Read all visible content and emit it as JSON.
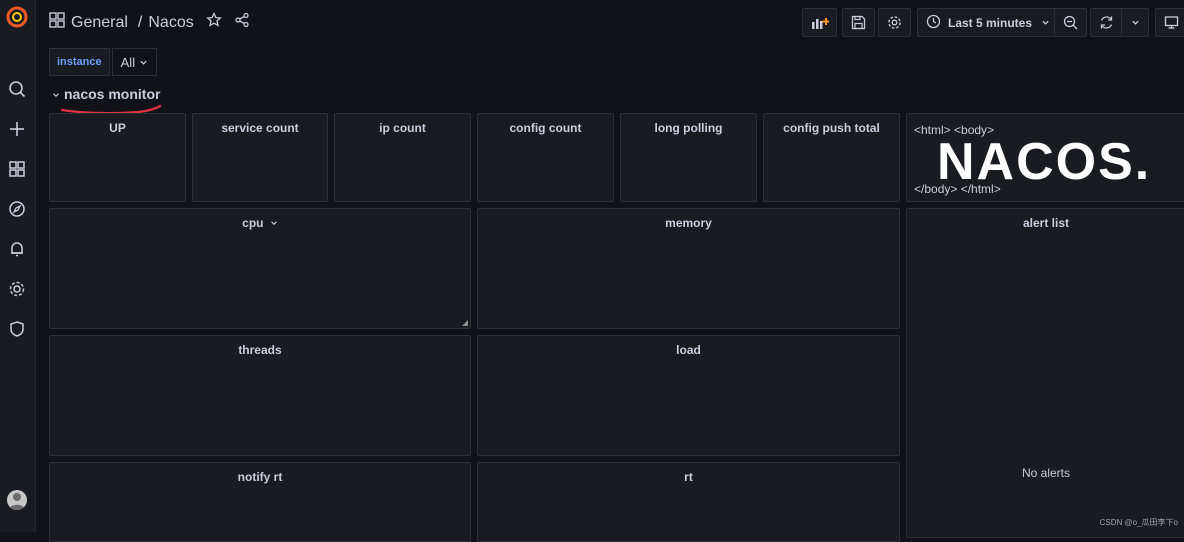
{
  "breadcrumb": {
    "folder": "General",
    "separator": "/",
    "dashboard": "Nacos"
  },
  "toolbar": {
    "time_range": "Last 5 minutes"
  },
  "variables": {
    "label": "instance",
    "value": "All"
  },
  "row": {
    "title": "nacos monitor"
  },
  "panels": {
    "up": "UP",
    "service_count": "service count",
    "ip_count": "ip count",
    "config_count": "config count",
    "long_polling": "long polling",
    "config_push_total": "config push total",
    "html_open": "<html> <body>",
    "html_logo": "NACOS.",
    "html_close": "</body> </html>",
    "cpu": "cpu",
    "memory": "memory",
    "alert_list": "alert list",
    "no_alerts": "No alerts",
    "threads": "threads",
    "load": "load",
    "notify_rt": "notify rt",
    "rt": "rt"
  },
  "watermark": "CSDN @o_瓜田李下o",
  "colors": {
    "accent": "#6e9fff",
    "panel_bg": "#181b1f",
    "page_bg": "#111217",
    "annotation": "#e02f44"
  }
}
